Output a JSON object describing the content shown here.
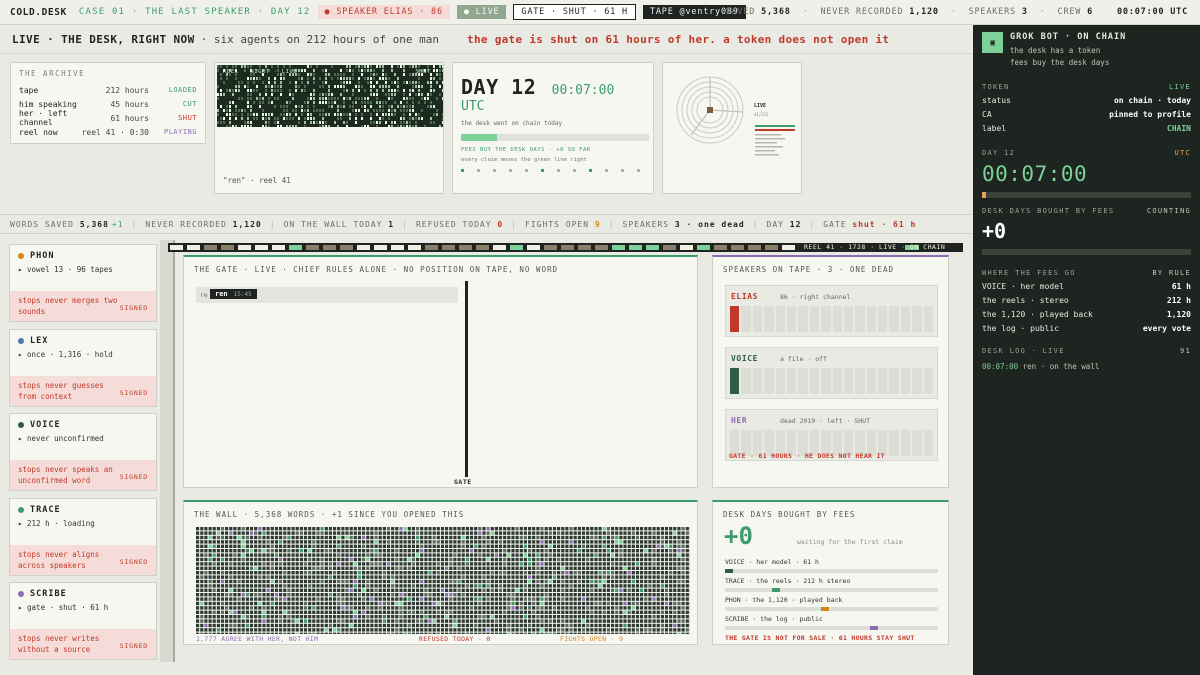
{
  "topbar": {
    "brand": "COLD.DESK",
    "case": "CASE 01 · THE LAST SPEAKER · DAY 12",
    "speaker_chip": "● SPEAKER ELIAS · 86",
    "live_chip": "● LIVE",
    "gate_chip": "GATE · SHUT · 61 H",
    "tape_chip": "TAPE @ventry089",
    "saved_label": "SAVED",
    "saved_value": "5,368",
    "never_label": "NEVER RECORDED",
    "never_value": "1,120",
    "speakers_label": "SPEAKERS",
    "speakers_value": "3",
    "crew_label": "CREW",
    "crew_value": "6",
    "clock": "00:07:00 UTC"
  },
  "liveline": {
    "title": "LIVE · THE DESK, RIGHT NOW",
    "subtitle": "· six agents on 212 hours of one man",
    "alert": "the gate is shut on 61 hours of her. a token does not open it"
  },
  "archive": {
    "title": "THE ARCHIVE",
    "rows": [
      {
        "k": "tape",
        "v": "212 hours",
        "s": "LOADED"
      },
      {
        "k": "him speaking",
        "v": "45 hours",
        "s": "CUT"
      },
      {
        "k": "her · left channel",
        "v": "61 hours",
        "s": "SHUT"
      },
      {
        "k": "reel now",
        "v": "reel 41 · 0:30",
        "s": "PLAYING"
      }
    ],
    "status_colors": [
      "#3f9b6c",
      "#3f9b6c",
      "#c0392b",
      "#8d6db3"
    ]
  },
  "spectro": {
    "overlay_left": "REEL · NIGHT · LIVE",
    "overlay_right": "SHUT",
    "caption": "\"ren\" · reel 41"
  },
  "daycard": {
    "day": "DAY 12",
    "clock": "00:07:00 UTC",
    "sub": "the desk went on chain today",
    "fees": "FEES BUY THE DESK DAYS · +0 SO FAR",
    "note": "every claim moves the green line right"
  },
  "radial": {
    "live": "LIVE",
    "sub": "41/212"
  },
  "strip": [
    {
      "label": "WORDS SAVED",
      "value": "5,368",
      "extra": "+1"
    },
    {
      "label": "NEVER RECORDED",
      "value": "1,120"
    },
    {
      "label": "ON THE WALL TODAY",
      "value": "1"
    },
    {
      "label": "REFUSED TODAY",
      "value": "0",
      "color": "#c0392b"
    },
    {
      "label": "FIGHTS OPEN",
      "value": "9",
      "color": "#d4861c"
    },
    {
      "label": "SPEAKERS",
      "value": "3 · one dead"
    },
    {
      "label": "DAY",
      "value": "12"
    },
    {
      "label": "GATE",
      "value": "shut · 61 h",
      "color": "#c0392b"
    }
  ],
  "agents": [
    {
      "name": "PHON",
      "color": "#d4861c",
      "status": "▸ vowel 13 · 96 tapes",
      "rule": "stops never merges two sounds",
      "signed": "SIGNED"
    },
    {
      "name": "LEX",
      "color": "#4a79b8",
      "status": "▸ once · 1,316 · hold",
      "rule": "stops never guesses from context",
      "signed": "SIGNED"
    },
    {
      "name": "VOICE",
      "color": "#2f5e45",
      "status": "▸ never unconfirmed",
      "rule": "stops never speaks an unconfirmed word",
      "signed": "SIGNED"
    },
    {
      "name": "TRACE",
      "color": "#3f9b6c",
      "status": "▸ 212 h · loading",
      "rule": "stops never aligns across speakers",
      "signed": "SIGNED"
    },
    {
      "name": "SCRIBE",
      "color": "#8d6db3",
      "status": "▸ gate · shut · 61 h",
      "rule": "stops never writes without a source",
      "signed": "SIGNED"
    }
  ],
  "timeline": {
    "text": "REEL 41 · 1728 · LIVE · ON CHAIN"
  },
  "gate": {
    "title": "THE GATE · LIVE · CHIEF RULES ALONE · NO POSITION ON TAPE, NO WORD",
    "placeholder": "re",
    "tag": "ren",
    "tag_time": "15:45",
    "label": "GATE"
  },
  "speakers": {
    "title": "SPEAKERS ON TAPE · 3 · ONE DEAD",
    "items": [
      {
        "name": "ELIAS",
        "desc": "86 · right channel",
        "color": "#c0392b",
        "fill": 1
      },
      {
        "name": "VOICE",
        "desc": "a file · off",
        "color": "#2f5e45",
        "fill": 1
      },
      {
        "name": "HER",
        "desc": "dead 2019 · left · SHUT",
        "color": "#8d6db3",
        "fill": 0
      }
    ],
    "footer": "GATE · 61 HOURS · HE DOES NOT HEAR IT"
  },
  "wall": {
    "title": "THE WALL · 5,368 WORDS · +1 SINCE YOU OPENED THIS",
    "foot_left": "1,777 AGREE WITH HER, NOT HIM",
    "foot_mid": "REFUSED TODAY · 0",
    "foot_right": "FIGHTS OPEN · 9"
  },
  "fees": {
    "title": "DESK DAYS BOUGHT BY FEES",
    "big": "+0",
    "wait": "waiting for the first claim",
    "rows": [
      {
        "label": "VOICE · her model · 61 h",
        "pos": 0.0,
        "color": "#2f5e45"
      },
      {
        "label": "TRACE · the reels · 212 h stereo",
        "pos": 0.22,
        "color": "#3f9b6c"
      },
      {
        "label": "PHON · the 1,120 · played back",
        "pos": 0.45,
        "color": "#d4861c"
      },
      {
        "label": "SCRIBE · the log · public",
        "pos": 0.68,
        "color": "#8d6db3"
      }
    ],
    "footer": "THE GATE IS NOT FOR SALE · 61 HOURS STAY SHUT"
  },
  "panel": {
    "logo": "▣",
    "title": "GROK BOT · ON CHAIN",
    "sub1": "the desk has a token",
    "sub2": "fees buy the desk days",
    "token_label": "TOKEN",
    "token_state": "LIVE",
    "rows": [
      {
        "k": "status",
        "v": "on chain · today"
      },
      {
        "k": "CA",
        "v": "pinned to profile"
      },
      {
        "k": "label",
        "v": "CHAIN"
      }
    ],
    "day_label": "DAY 12",
    "day_tz": "UTC",
    "clock": "00:07:00",
    "bought_label": "DESK DAYS BOUGHT BY FEES",
    "bought_state": "COUNTING",
    "bought_value": "+0",
    "where_label": "WHERE THE FEES GO",
    "where_state": "BY RULE",
    "where_rows": [
      {
        "k": "VOICE · her model",
        "v": "61 h"
      },
      {
        "k": "the reels · stereo",
        "v": "212 h"
      },
      {
        "k": "the 1,120 · played back",
        "v": "1,120"
      },
      {
        "k": "the log · public",
        "v": "every vote"
      }
    ],
    "log_label": "DESK LOG · LIVE",
    "log_count": "91",
    "log_time": "00:07:00",
    "log_text": "ren · on the wall"
  }
}
